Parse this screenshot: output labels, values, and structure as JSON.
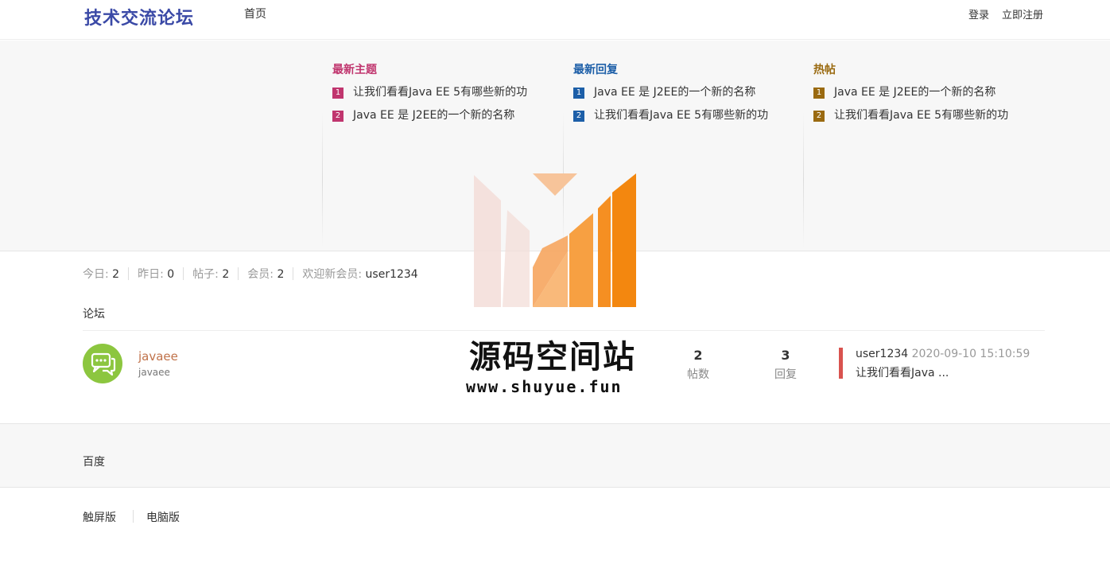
{
  "header": {
    "logo": "技术交流论坛",
    "nav_home": "首页",
    "login": "登录",
    "register": "立即注册"
  },
  "colors": {
    "logo": "#3a49a6",
    "new_topics": "#c0356e",
    "new_replies": "#1d5fa8",
    "hot": "#9a6a10",
    "last_post_bar": "#d9534f",
    "avatar": "#8cc63f"
  },
  "lists": [
    {
      "title": "最新主题",
      "items": [
        {
          "num": "1",
          "text": "让我们看看Java EE 5有哪些新的功"
        },
        {
          "num": "2",
          "text": "Java EE 是 J2EE的一个新的名称"
        }
      ]
    },
    {
      "title": "最新回复",
      "items": [
        {
          "num": "1",
          "text": "Java EE 是 J2EE的一个新的名称"
        },
        {
          "num": "2",
          "text": "让我们看看Java EE 5有哪些新的功"
        }
      ]
    },
    {
      "title": "热帖",
      "items": [
        {
          "num": "1",
          "text": "Java EE 是 J2EE的一个新的名称"
        },
        {
          "num": "2",
          "text": "让我们看看Java EE 5有哪些新的功"
        }
      ]
    }
  ],
  "stats": {
    "today_label": "今日:",
    "today": "2",
    "yesterday_label": "昨日:",
    "yesterday": "0",
    "posts_label": "帖子:",
    "posts": "2",
    "members_label": "会员:",
    "members": "2",
    "welcome_label": "欢迎新会员:",
    "welcome_user": "user1234"
  },
  "forum": {
    "section_label": "论坛",
    "name": "javaee",
    "desc": "javaee",
    "avatar_icon": "chat-bubbles-icon",
    "threads": "2",
    "threads_label": "帖数",
    "replies": "3",
    "replies_label": "回复",
    "last_user": "user1234",
    "last_time": "2020-09-10 15:10:59",
    "last_title": "让我们看看Java ..."
  },
  "friend_link": "百度",
  "footer": {
    "touch": "触屏版",
    "desktop": "电脑版"
  },
  "watermark": {
    "text": "源码空间站",
    "url": "www.shuyue.fun"
  }
}
